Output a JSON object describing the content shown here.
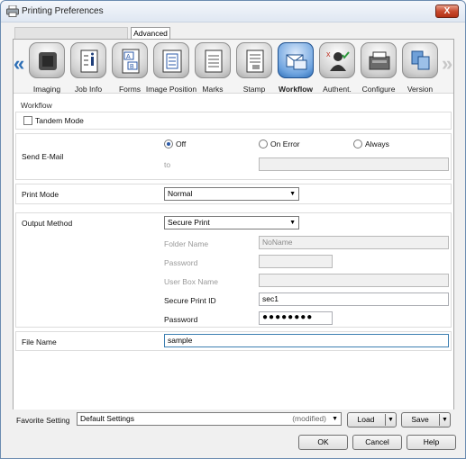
{
  "window": {
    "title": "Printing Preferences",
    "close_label": "X"
  },
  "tabs": {
    "advanced": "Advanced"
  },
  "nav": {
    "prev_arrow": "«",
    "next_arrow": "»",
    "items": [
      {
        "label": "Imaging",
        "icon": "imaging-icon"
      },
      {
        "label": "Job Info",
        "icon": "job-info-icon"
      },
      {
        "label": "Forms",
        "icon": "forms-icon"
      },
      {
        "label": "Image Position",
        "icon": "image-position-icon"
      },
      {
        "label": "Marks",
        "icon": "marks-icon"
      },
      {
        "label": "Stamp",
        "icon": "stamp-icon"
      },
      {
        "label": "Workflow",
        "icon": "workflow-icon",
        "active": true
      },
      {
        "label": "Authent.",
        "icon": "authentication-icon"
      },
      {
        "label": "Configure",
        "icon": "configure-icon"
      },
      {
        "label": "Version",
        "icon": "version-icon"
      }
    ]
  },
  "workflow": {
    "section_title": "Workflow",
    "tandem_mode": {
      "label": "Tandem Mode",
      "checked": false
    },
    "send_email": {
      "label": "Send E-Mail",
      "options": [
        "Off",
        "On Error",
        "Always"
      ],
      "selected": "Off",
      "to_label": "to",
      "to_value": ""
    },
    "print_mode": {
      "label": "Print Mode",
      "value": "Normal"
    },
    "output_method": {
      "label": "Output Method",
      "value": "Secure Print",
      "folder_name_label": "Folder Name",
      "folder_name_value": "NoName",
      "password_label_disabled": "Password",
      "user_box_name_label": "User Box Name",
      "secure_print_id_label": "Secure Print ID",
      "secure_print_id_value": "sec1",
      "password_label": "Password",
      "password_value": "●●●●●●●●"
    },
    "file_name": {
      "label": "File Name",
      "value": "sample"
    }
  },
  "favorite": {
    "label": "Favorite Setting",
    "value": "Default Settings",
    "modified": "(modified)",
    "load": "Load",
    "save": "Save"
  },
  "footer": {
    "ok": "OK",
    "cancel": "Cancel",
    "help": "Help"
  },
  "colors": {
    "accent": "#2d6fb6",
    "active_icon": "#3b7cc7"
  }
}
